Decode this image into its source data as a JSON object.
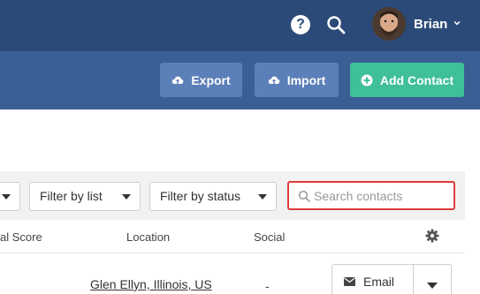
{
  "header": {
    "help_icon": "question-circle-icon",
    "help_symbol": "?",
    "search_icon": "search-icon",
    "user": {
      "name": "Brian",
      "avatar_icon": "avatar"
    }
  },
  "toolbar": {
    "export_label": "Export",
    "import_label": "Import",
    "add_contact_label": "Add Contact"
  },
  "filters": {
    "list_label": "Filter by list",
    "status_label": "Filter by status",
    "search_placeholder": "Search contacts",
    "search_value": ""
  },
  "table": {
    "columns": [
      "al Score",
      "Location",
      "Social"
    ],
    "rows": [
      {
        "location": "Glen Ellyn, Illinois, US",
        "social": "-",
        "action_label": "Email"
      }
    ]
  },
  "colors": {
    "topbar": "#2c4a78",
    "actionbar": "#3a5f95",
    "secondary_button": "#5b7fb8",
    "primary_button": "#3fbf9a",
    "search_highlight": "#e03a3a"
  }
}
